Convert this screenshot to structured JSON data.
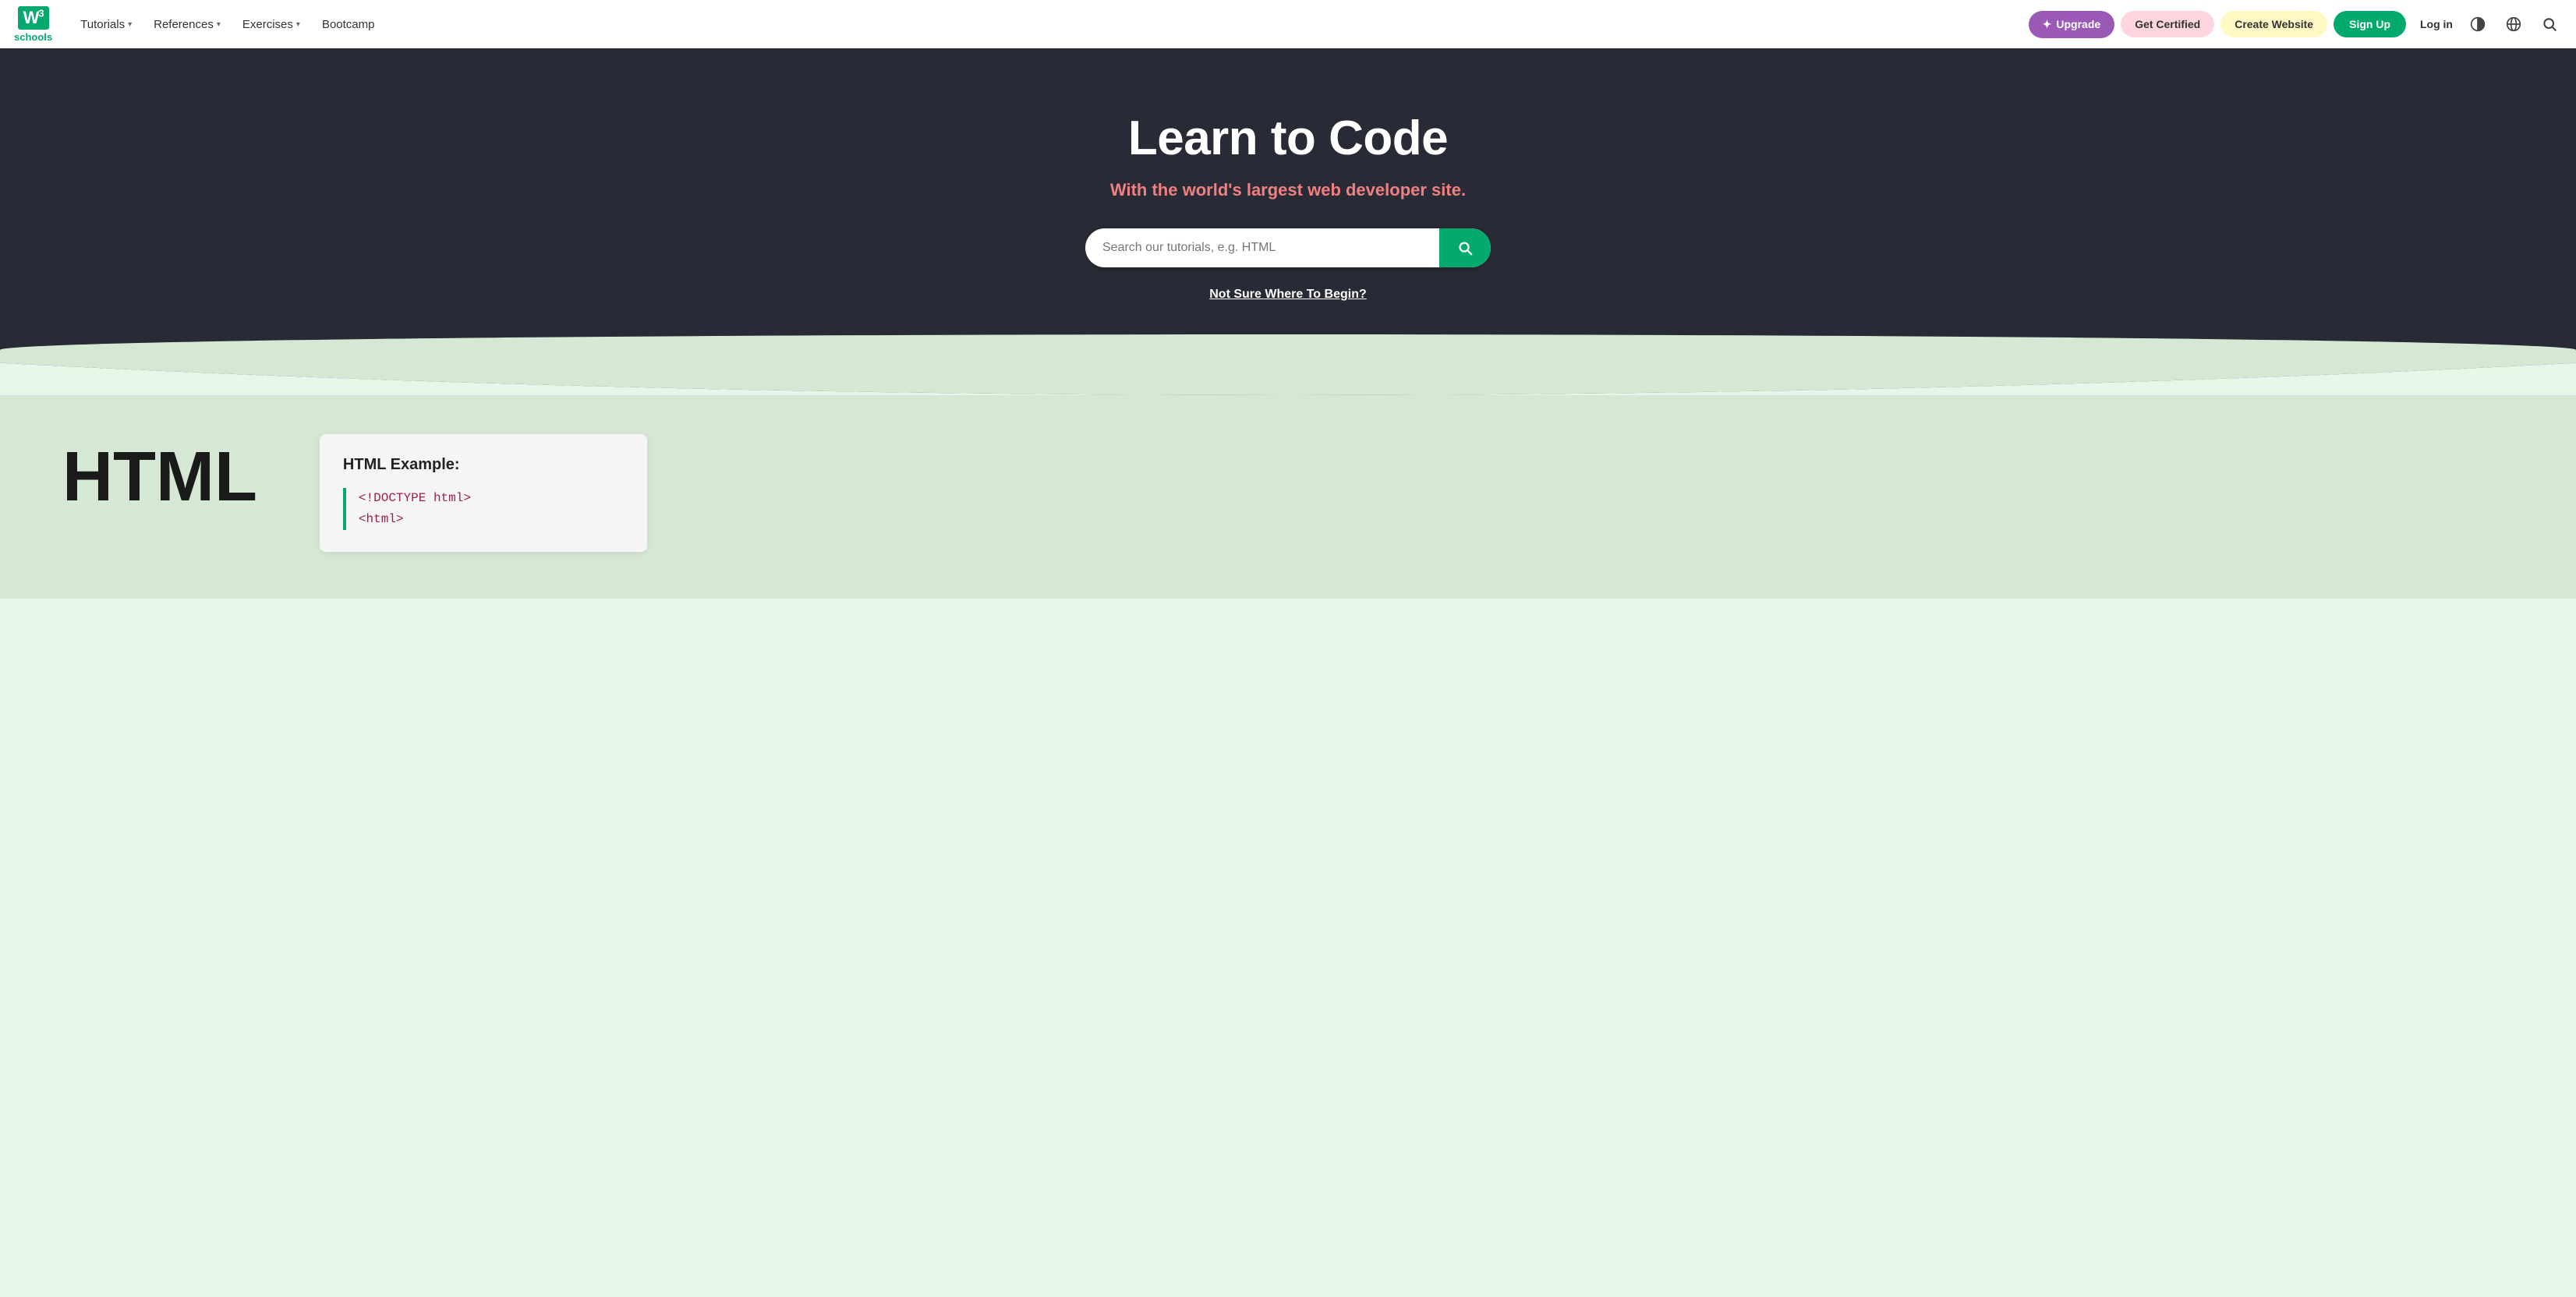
{
  "nav": {
    "logo_text": "W",
    "logo_sup": "3",
    "logo_schools": "schools",
    "links": [
      {
        "label": "Tutorials",
        "has_dropdown": true
      },
      {
        "label": "References",
        "has_dropdown": true
      },
      {
        "label": "Exercises",
        "has_dropdown": true
      },
      {
        "label": "Bootcamp",
        "has_dropdown": false
      }
    ],
    "upgrade_label": "Upgrade",
    "certified_label": "Get Certified",
    "create_label": "Create Website",
    "signup_label": "Sign Up",
    "login_label": "Log in"
  },
  "hero": {
    "heading": "Learn to Code",
    "subtitle": "With the world's largest web developer site.",
    "search_placeholder": "Search our tutorials, e.g. HTML",
    "not_sure_label": "Not Sure Where To Begin?"
  },
  "content": {
    "html_label": "HTML",
    "example_title": "HTML Example:",
    "code_lines": [
      "<!DOCTYPE html>",
      "<html>"
    ]
  }
}
